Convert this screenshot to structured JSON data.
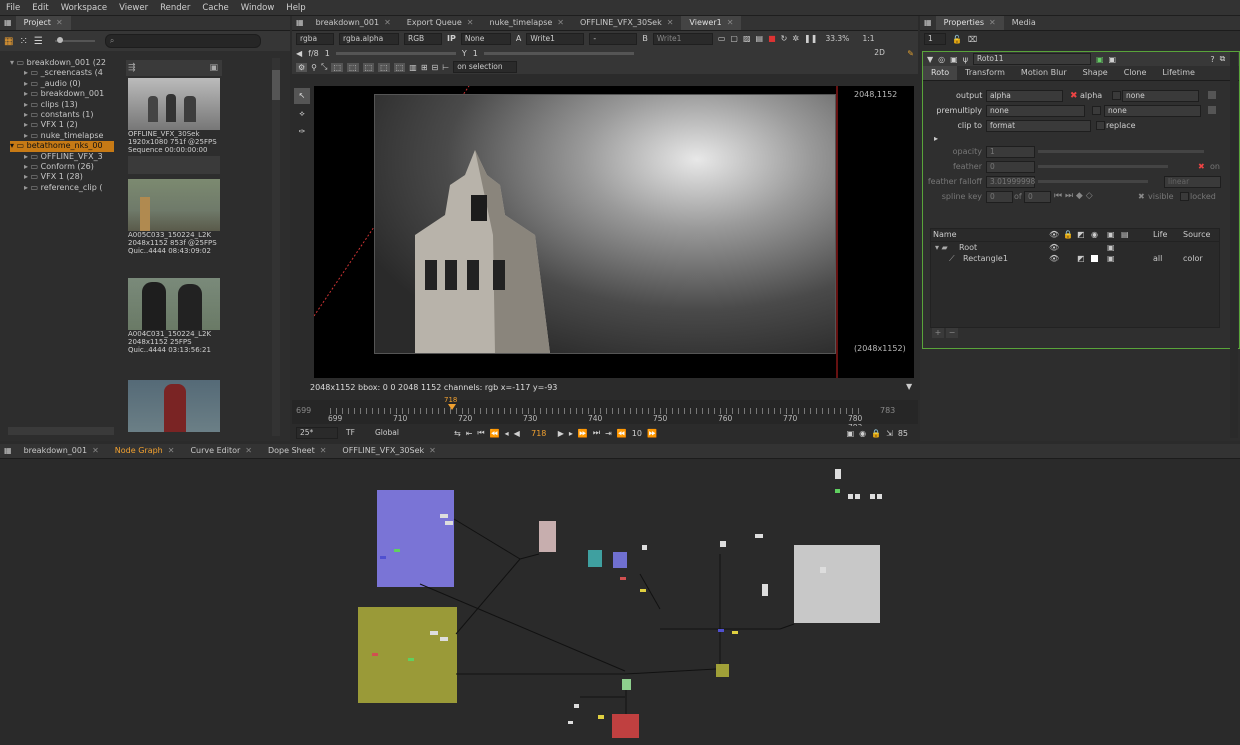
{
  "menu": [
    "File",
    "Edit",
    "Workspace",
    "Viewer",
    "Render",
    "Cache",
    "Window",
    "Help"
  ],
  "project": {
    "tab": "Project",
    "tree": [
      {
        "label": "breakdown_001 (22",
        "indent": 0,
        "sel": false
      },
      {
        "label": "_screencasts (4",
        "indent": 1,
        "sel": false
      },
      {
        "label": "_audio (0)",
        "indent": 1,
        "sel": false
      },
      {
        "label": "breakdown_001",
        "indent": 1,
        "sel": false
      },
      {
        "label": "clips (13)",
        "indent": 1,
        "sel": false
      },
      {
        "label": "constants (1)",
        "indent": 1,
        "sel": false
      },
      {
        "label": "VFX 1 (2)",
        "indent": 1,
        "sel": false
      },
      {
        "label": "nuke_timelapse",
        "indent": 1,
        "sel": false
      },
      {
        "label": "betathome_nks_00",
        "indent": 0,
        "sel": true
      },
      {
        "label": "OFFLINE_VFX_3",
        "indent": 1,
        "sel": false
      },
      {
        "label": "Conform (26)",
        "indent": 1,
        "sel": false
      },
      {
        "label": "VFX 1 (28)",
        "indent": 1,
        "sel": false
      },
      {
        "label": "reference_clip (",
        "indent": 1,
        "sel": false
      }
    ],
    "thumbs": [
      {
        "name": "OFFLINE_VFX_30Sek",
        "line2": "1920x1080 751f @25FPS",
        "line3": "Sequence      00:00:00:00"
      },
      {
        "name": "A005C033_150224_L2K",
        "line2": "2048x1152 853f @25FPS",
        "line3": "Quic..4444    08:43:09:02"
      },
      {
        "name": "A004C031_150224_L2K",
        "line2": "2048x1152         25FPS",
        "line3": "Quic..4444    03:13:56:21"
      }
    ]
  },
  "viewer": {
    "tabs": [
      "breakdown_001",
      "Export Queue",
      "nuke_timelapse",
      "OFFLINE_VFX_30Sek",
      "Viewer1"
    ],
    "active_tab": "Viewer1",
    "toolbar1": {
      "channels": "rgba",
      "layer": "rgba.alpha",
      "colorspace": "RGB",
      "ip": "IP",
      "none": "None",
      "a_input": "Write1",
      "dash": "-",
      "b_input": "Write1",
      "zoom": "33.3%",
      "ratio": "1:1"
    },
    "toolbar2": {
      "fstop": "f/8",
      "gain": "1",
      "y_label": "Y",
      "gamma": "1",
      "view": "2D"
    },
    "toolbar3": {
      "roi": "on selection"
    },
    "res_top": "2048,1152",
    "res_bottom": "(2048x1152)",
    "status": "2048x1152  bbox: 0 0 2048 1152 channels: rgb   x=-117 y=-93",
    "timeline": {
      "start": "699",
      "end": "783",
      "current": "718",
      "ticks": [
        "699",
        "710",
        "720",
        "730",
        "740",
        "750",
        "760",
        "770",
        "780 783"
      ],
      "fps": "25*",
      "tf": "TF",
      "global": "Global",
      "frame": "718",
      "step": "10",
      "last": "85"
    }
  },
  "properties": {
    "tabs": [
      "Properties",
      "Media"
    ],
    "count": "1",
    "node_name": "Roto11",
    "subtabs": [
      "Roto",
      "Transform",
      "Motion Blur",
      "Shape",
      "Clone",
      "Lifetime"
    ],
    "rows": {
      "output_label": "output",
      "output_val": "alpha",
      "alpha_label": "alpha",
      "none1": "none",
      "premult_label": "premultiply",
      "premult_val": "none",
      "none2": "none",
      "clip_label": "clip to",
      "clip_val": "format",
      "replace_label": "replace",
      "opacity_label": "opacity",
      "opacity_val": "1",
      "feather_label": "feather",
      "feather_val": "0",
      "on_label": "on",
      "falloff_label": "feather falloff",
      "falloff_val": "3.01999998",
      "falloff_mode": "linear",
      "spline_label": "spline key",
      "spline_val": "0",
      "of_label": "of",
      "of_val": "0",
      "visible_label": "visible",
      "locked_label": "locked"
    },
    "columns": {
      "name": "Name",
      "life": "Life",
      "source": "Source"
    },
    "layers": [
      {
        "name": "Root",
        "life": "",
        "source": ""
      },
      {
        "name": "Rectangle1",
        "life": "all",
        "source": "color"
      }
    ]
  },
  "nodegraph": {
    "tabs": [
      "breakdown_001",
      "Node Graph",
      "Curve Editor",
      "Dope Sheet",
      "OFFLINE_VFX_30Sek"
    ],
    "active_tab": "Node Graph"
  }
}
